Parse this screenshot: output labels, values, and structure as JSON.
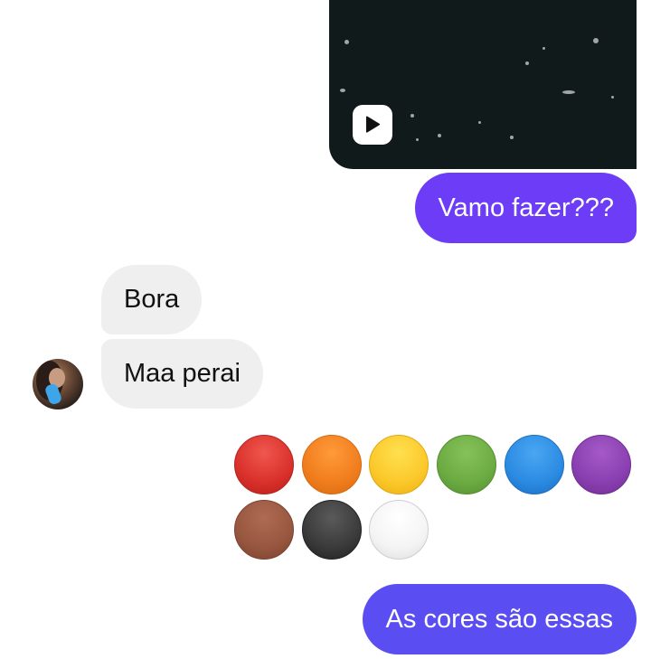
{
  "chat": {
    "video_message": {
      "play_icon": "play-icon"
    },
    "messages": {
      "outgoing_1": "Vamo fazer???",
      "incoming_1": "Bora",
      "incoming_2": "Maa perai",
      "outgoing_2": "As cores são essas"
    },
    "colors": {
      "outgoing_1_bubble": "#6c3cf6",
      "outgoing_2_bubble": "#5a4ef2",
      "incoming_bubble": "#efefef"
    },
    "avatar": {
      "icon": "contact-avatar"
    },
    "color_palette": [
      {
        "name": "red",
        "hex": "#e03a33"
      },
      {
        "name": "orange",
        "hex": "#f07d1d"
      },
      {
        "name": "yellow",
        "hex": "#fbc82a"
      },
      {
        "name": "green",
        "hex": "#6bab42"
      },
      {
        "name": "blue",
        "hex": "#2b8be2"
      },
      {
        "name": "purple",
        "hex": "#8a3fb0"
      },
      {
        "name": "brown",
        "hex": "#97563f"
      },
      {
        "name": "black",
        "hex": "#3a3a3a"
      },
      {
        "name": "white",
        "hex": "#f4f4f4"
      }
    ]
  }
}
